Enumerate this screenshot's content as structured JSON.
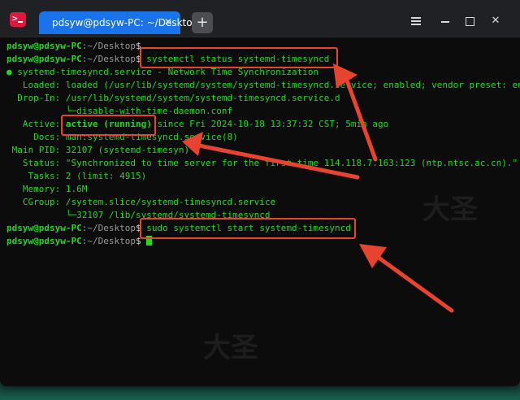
{
  "window": {
    "tab_title": "pdsyw@pdsyw-PC: ~/Desktop",
    "tab_close_glyph": "✕",
    "new_tab_glyph": "+",
    "close_glyph": "✕"
  },
  "prompt": {
    "user": "pdsyw@pdsyw-PC",
    "path": ":~/Desktop",
    "dollar": "$"
  },
  "commands": {
    "status": "systemctl status systemd-timesyncd",
    "start": "sudo systemctl start systemd-timesyncd"
  },
  "output": {
    "unit_dot": "●",
    "unit_line": " systemd-timesyncd.service - Network Time Synchronization",
    "loaded": "   Loaded: loaded (/usr/lib/systemd/system/systemd-timesyncd.service; enabled; vendor preset: enabl",
    "dropin": "  Drop-In: /usr/lib/systemd/system/systemd-timesyncd.service.d",
    "dropin_file": "           └─disable-with-time-daemon.conf",
    "active_label": "   Active: ",
    "active_state": "active (running)",
    "active_since": " since Fri 2024-10-18 13:37:32 CST; 5min ago",
    "docs": "     Docs: man:systemd-timesyncd.service(8)",
    "main_pid": " Main PID: 32107 (systemd-timesyn)",
    "status": "   Status: \"Synchronized to time server for the first time 114.118.7.163:123 (ntp.ntsc.ac.cn).\"",
    "tasks": "    Tasks: 2 (limit: 4915)",
    "memory": "   Memory: 1.6M",
    "cgroup": "   CGroup: /system.slice/systemd-timesyncd.service",
    "cgroup_child": "           └─32107 /lib/systemd/systemd-timesyncd"
  },
  "watermark_text": "大圣",
  "colors": {
    "terminal_green": "#22d622",
    "tab_blue": "#1a73e8",
    "annotation_red": "#e8432e",
    "app_icon_red": "#e0183e"
  }
}
